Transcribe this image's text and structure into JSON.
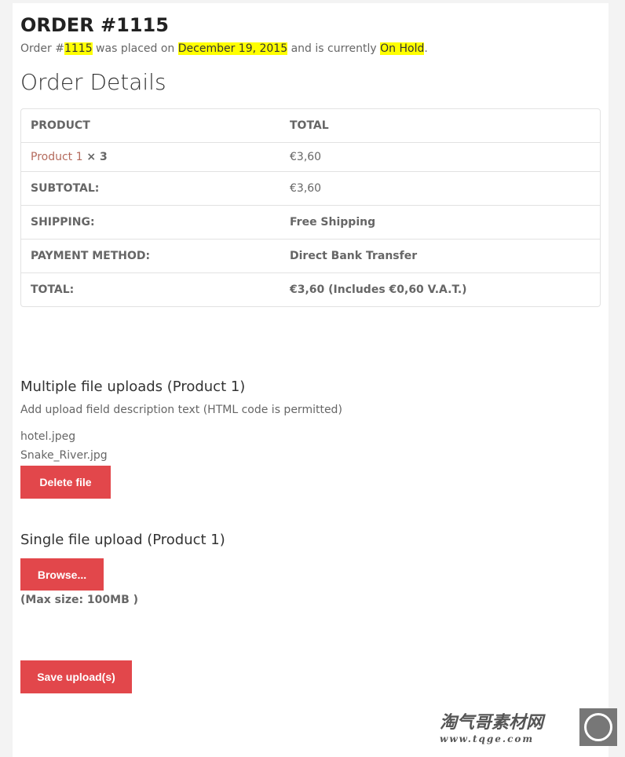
{
  "order": {
    "title": "ORDER #1115",
    "intro_prefix": "Order #",
    "number": "1115",
    "intro_mid1": " was placed on ",
    "date": "December 19, 2015",
    "intro_mid2": " and is currently ",
    "status": "On Hold",
    "intro_end": "."
  },
  "details": {
    "heading": "Order Details",
    "headers": [
      "PRODUCT",
      "TOTAL"
    ],
    "item": {
      "name": "Product 1",
      "qty": " × 3",
      "total": "€3,60"
    },
    "rows": [
      {
        "label": "SUBTOTAL:",
        "value": "€3,60"
      },
      {
        "label": "SHIPPING:",
        "value": "Free Shipping"
      },
      {
        "label": "PAYMENT METHOD:",
        "value": "Direct Bank Transfer"
      },
      {
        "label": "TOTAL:",
        "value": "€3,60  (Includes €0,60  V.A.T.)"
      }
    ]
  },
  "multi": {
    "heading": "Multiple file uploads (Product 1)",
    "description": "Add upload field description text (HTML code is permitted)",
    "files": [
      "hotel.jpeg",
      "Snake_River.jpg"
    ],
    "delete_label": "Delete file"
  },
  "single": {
    "heading": "Single file upload (Product 1)",
    "browse_label": "Browse...",
    "max_size": "(Max size: 100MB )"
  },
  "save_label": "Save upload(s)",
  "watermark": {
    "text": "淘气哥素材网",
    "url": "www.tqge.com"
  }
}
